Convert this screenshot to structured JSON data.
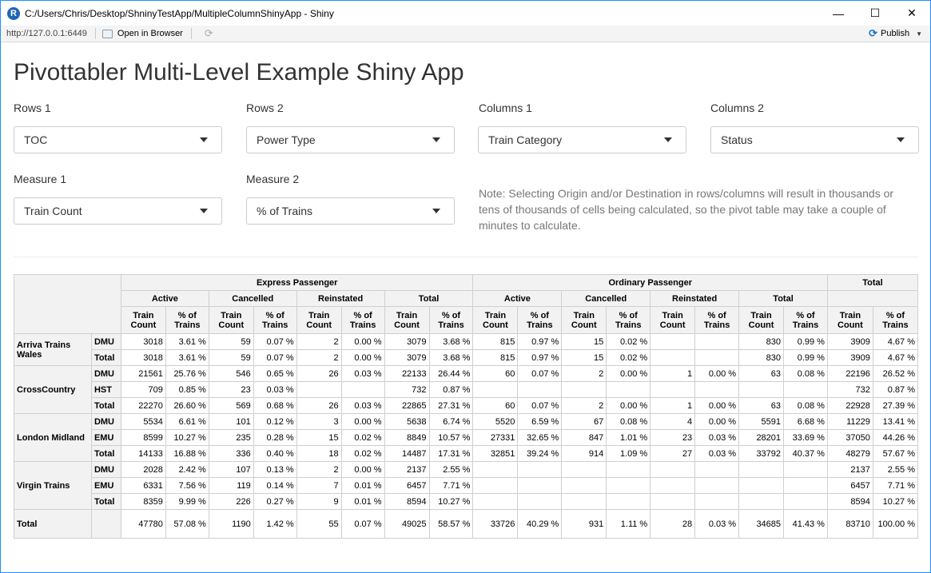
{
  "window": {
    "app_icon": "R",
    "title": "C:/Users/Chris/Desktop/ShninyTestApp/MultipleColumnShinyApp - Shiny",
    "url": "http://127.0.0.1:6449",
    "open_in_browser": "Open in Browser",
    "publish": "Publish",
    "icons": [
      "r-logo-icon",
      "minimize-icon",
      "maximize-icon",
      "close-icon",
      "browser-icon",
      "refresh-icon",
      "publish-icon",
      "chevron-down-icon"
    ]
  },
  "page": {
    "title": "Pivottabler Multi-Level Example Shiny App",
    "note": "Note: Selecting Origin and/or Destination in rows/columns will result in thousands or tens of thousands of cells being calculated, so the pivot table may take a couple of minutes to calculate."
  },
  "controls": {
    "rows1": {
      "label": "Rows 1",
      "value": "TOC"
    },
    "rows2": {
      "label": "Rows 2",
      "value": "Power Type"
    },
    "cols1": {
      "label": "Columns 1",
      "value": "Train Category"
    },
    "cols2": {
      "label": "Columns 2",
      "value": "Status"
    },
    "measure1": {
      "label": "Measure 1",
      "value": "Train Count"
    },
    "measure2": {
      "label": "Measure 2",
      "value": "% of Trains"
    }
  },
  "pivot": {
    "groups": [
      "Express Passenger",
      "Ordinary Passenger"
    ],
    "grand_total": "Total",
    "statuses": [
      "Active",
      "Cancelled",
      "Reinstated",
      "Total"
    ],
    "measures": [
      "Train\nCount",
      "% of\nTrains"
    ],
    "rows": [
      {
        "toc": "Arriva Trains Wales",
        "subs": [
          {
            "label": "DMU",
            "cells": [
              "3018",
              "3.61 %",
              "59",
              "0.07 %",
              "2",
              "0.00 %",
              "3079",
              "3.68 %",
              "815",
              "0.97 %",
              "15",
              "0.02 %",
              "",
              "",
              "830",
              "0.99 %",
              "3909",
              "4.67 %"
            ]
          },
          {
            "label": "Total",
            "cells": [
              "3018",
              "3.61 %",
              "59",
              "0.07 %",
              "2",
              "0.00 %",
              "3079",
              "3.68 %",
              "815",
              "0.97 %",
              "15",
              "0.02 %",
              "",
              "",
              "830",
              "0.99 %",
              "3909",
              "4.67 %"
            ]
          }
        ]
      },
      {
        "toc": "CrossCountry",
        "subs": [
          {
            "label": "DMU",
            "cells": [
              "21561",
              "25.76 %",
              "546",
              "0.65 %",
              "26",
              "0.03 %",
              "22133",
              "26.44 %",
              "60",
              "0.07 %",
              "2",
              "0.00 %",
              "1",
              "0.00 %",
              "63",
              "0.08 %",
              "22196",
              "26.52 %"
            ]
          },
          {
            "label": "HST",
            "cells": [
              "709",
              "0.85 %",
              "23",
              "0.03 %",
              "",
              "",
              "732",
              "0.87 %",
              "",
              "",
              "",
              "",
              "",
              "",
              "",
              "",
              "732",
              "0.87 %"
            ]
          },
          {
            "label": "Total",
            "cells": [
              "22270",
              "26.60 %",
              "569",
              "0.68 %",
              "26",
              "0.03 %",
              "22865",
              "27.31 %",
              "60",
              "0.07 %",
              "2",
              "0.00 %",
              "1",
              "0.00 %",
              "63",
              "0.08 %",
              "22928",
              "27.39 %"
            ]
          }
        ]
      },
      {
        "toc": "London Midland",
        "subs": [
          {
            "label": "DMU",
            "cells": [
              "5534",
              "6.61 %",
              "101",
              "0.12 %",
              "3",
              "0.00 %",
              "5638",
              "6.74 %",
              "5520",
              "6.59 %",
              "67",
              "0.08 %",
              "4",
              "0.00 %",
              "5591",
              "6.68 %",
              "11229",
              "13.41 %"
            ]
          },
          {
            "label": "EMU",
            "cells": [
              "8599",
              "10.27 %",
              "235",
              "0.28 %",
              "15",
              "0.02 %",
              "8849",
              "10.57 %",
              "27331",
              "32.65 %",
              "847",
              "1.01 %",
              "23",
              "0.03 %",
              "28201",
              "33.69 %",
              "37050",
              "44.26 %"
            ]
          },
          {
            "label": "Total",
            "cells": [
              "14133",
              "16.88 %",
              "336",
              "0.40 %",
              "18",
              "0.02 %",
              "14487",
              "17.31 %",
              "32851",
              "39.24 %",
              "914",
              "1.09 %",
              "27",
              "0.03 %",
              "33792",
              "40.37 %",
              "48279",
              "57.67 %"
            ]
          }
        ]
      },
      {
        "toc": "Virgin Trains",
        "subs": [
          {
            "label": "DMU",
            "cells": [
              "2028",
              "2.42 %",
              "107",
              "0.13 %",
              "2",
              "0.00 %",
              "2137",
              "2.55 %",
              "",
              "",
              "",
              "",
              "",
              "",
              "",
              "",
              "2137",
              "2.55 %"
            ]
          },
          {
            "label": "EMU",
            "cells": [
              "6331",
              "7.56 %",
              "119",
              "0.14 %",
              "7",
              "0.01 %",
              "6457",
              "7.71 %",
              "",
              "",
              "",
              "",
              "",
              "",
              "",
              "",
              "6457",
              "7.71 %"
            ]
          },
          {
            "label": "Total",
            "cells": [
              "8359",
              "9.99 %",
              "226",
              "0.27 %",
              "9",
              "0.01 %",
              "8594",
              "10.27 %",
              "",
              "",
              "",
              "",
              "",
              "",
              "",
              "",
              "8594",
              "10.27 %"
            ]
          }
        ]
      }
    ],
    "total_row": {
      "label": "Total",
      "cells": [
        "47780",
        "57.08 %",
        "1190",
        "1.42 %",
        "55",
        "0.07 %",
        "49025",
        "58.57 %",
        "33726",
        "40.29 %",
        "931",
        "1.11 %",
        "28",
        "0.03 %",
        "34685",
        "41.43 %",
        "83710",
        "100.00 %"
      ]
    }
  }
}
